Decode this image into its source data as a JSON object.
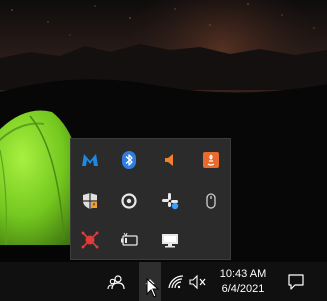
{
  "tray_overflow": {
    "icons": [
      {
        "name": "malwarebytes-icon",
        "color": "#1e88e5"
      },
      {
        "name": "bluetooth-icon",
        "color": "#2f7de1"
      },
      {
        "name": "speaker-orange-icon",
        "color": "#f08030"
      },
      {
        "name": "java-update-icon",
        "color": "#e86a2c"
      },
      {
        "name": "windows-security-icon",
        "color": "#e0e0e0"
      },
      {
        "name": "logitech-options-icon",
        "color": "#e8e8e8"
      },
      {
        "name": "slack-icon",
        "color": "#3aa0ff"
      },
      {
        "name": "mouse-icon",
        "color": "#cfcfcf"
      },
      {
        "name": "red-network-app-icon",
        "color": "#e03a3a"
      },
      {
        "name": "battery-icon",
        "color": "#e8e8e8"
      },
      {
        "name": "display-icon",
        "color": "#e8e8e8"
      }
    ]
  },
  "taskbar": {
    "people_icon": "people-icon",
    "overflow_chevron": "chevron-up-icon",
    "network_icon": "wifi-icon",
    "volume_icon": "volume-muted-icon",
    "clock": {
      "time": "10:43 AM",
      "date": "6/4/2021"
    },
    "notification_icon": "action-center-icon"
  },
  "colors": {
    "taskbar_bg": "#101010",
    "flyout_bg": "#2b2b2b",
    "tent_green": "#7bd428"
  }
}
